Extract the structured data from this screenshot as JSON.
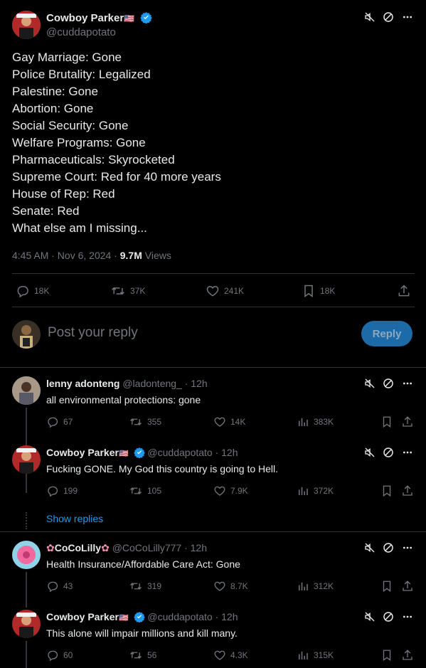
{
  "main_tweet": {
    "author_name": "Cowboy Parker",
    "author_emoji": "🇺🇸",
    "handle": "@cuddapotato",
    "lines": [
      "Gay Marriage: Gone",
      "Police Brutality: Legalized",
      "Palestine: Gone",
      "Abortion: Gone",
      "Social Security: Gone",
      "Welfare Programs: Gone",
      "Pharmaceuticals: Skyrocketed",
      "Supreme Court: Red for 40 more years",
      "House of Rep: Red",
      "Senate: Red",
      "What else am I missing..."
    ],
    "time": "4:45 AM · Nov 6, 2024 · ",
    "views_count": "9.7M",
    "views_label": " Views",
    "replies": "18K",
    "reposts": "37K",
    "likes": "241K",
    "bookmarks": "18K"
  },
  "composer": {
    "placeholder": "Post your reply",
    "button_label": "Reply"
  },
  "replies": [
    {
      "name": "lenny adonteng",
      "handle": "@ladonteng_",
      "time": "· 12h",
      "text": "all environmental protections: gone",
      "replies": "67",
      "reposts": "355",
      "likes": "14K",
      "views": "383K",
      "verified": false
    },
    {
      "name": "Cowboy Parker",
      "handle": "@cuddapotato",
      "time": "· 12h",
      "text": "Fucking GONE. My God this country is going to Hell.",
      "replies": "199",
      "reposts": "105",
      "likes": "7.9K",
      "views": "372K",
      "verified": true
    },
    {
      "name": "CoCoLilly",
      "handle": "@CoCoLilly777",
      "time": "· 12h",
      "text": "Health Insurance/Affordable Care Act: Gone",
      "replies": "43",
      "reposts": "319",
      "likes": "8.7K",
      "views": "312K",
      "verified": false
    },
    {
      "name": "Cowboy Parker",
      "handle": "@cuddapotato",
      "time": "· 12h",
      "text": "This alone will impair millions and kill many.",
      "replies": "60",
      "reposts": "56",
      "likes": "4.3K",
      "views": "315K",
      "verified": true
    }
  ],
  "show_replies_label": "Show replies",
  "colors": {
    "accent": "#1d9bf0",
    "muted": "#71767b",
    "background": "#000000",
    "divider": "#2f3336"
  }
}
